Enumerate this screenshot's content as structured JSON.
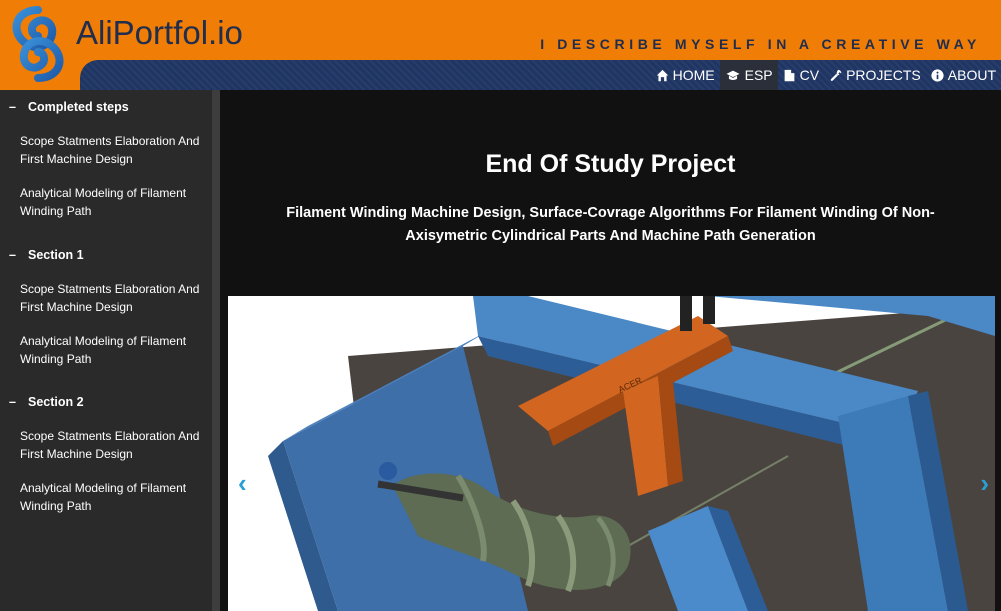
{
  "header": {
    "brand": "AliPortfol.io",
    "tagline": "I DESCRIBE MYSELF IN A CREATIVE WAY",
    "colors": {
      "orange": "#f07d05",
      "navy": "#1f3563",
      "logo_blue": "#2a7fc9"
    }
  },
  "nav": {
    "items": [
      {
        "label": "HOME",
        "icon": "home-icon"
      },
      {
        "label": "ESP",
        "icon": "graduation-cap-icon",
        "active": true
      },
      {
        "label": "CV",
        "icon": "document-icon"
      },
      {
        "label": "PROJECTS",
        "icon": "wrench-icon"
      },
      {
        "label": "ABOUT",
        "icon": "info-icon"
      }
    ]
  },
  "sidebar": {
    "sections": [
      {
        "dash": "–",
        "title": "Completed steps",
        "links": [
          "Scope Statments Elaboration And First Machine Design",
          "Analytical Modeling of Filament Winding Path"
        ]
      },
      {
        "dash": "–",
        "title": "Section 1",
        "links": [
          "Scope Statments Elaboration And First Machine Design",
          "Analytical Modeling of Filament Winding Path"
        ]
      },
      {
        "dash": "–",
        "title": "Section 2",
        "links": [
          "Scope Statments Elaboration And First Machine Design",
          "Analytical Modeling of Filament Winding Path"
        ]
      }
    ]
  },
  "main": {
    "title": "End Of Study Project",
    "subtitle": "Filament Winding Machine Design, Surface-Covrage Algorithms For Filament Winding Of Non-Axisymetric Cylindrical Parts And Machine Path Generation",
    "carousel": {
      "prev_glyph": "‹",
      "next_glyph": "›",
      "brand_mark": "ACER"
    }
  }
}
